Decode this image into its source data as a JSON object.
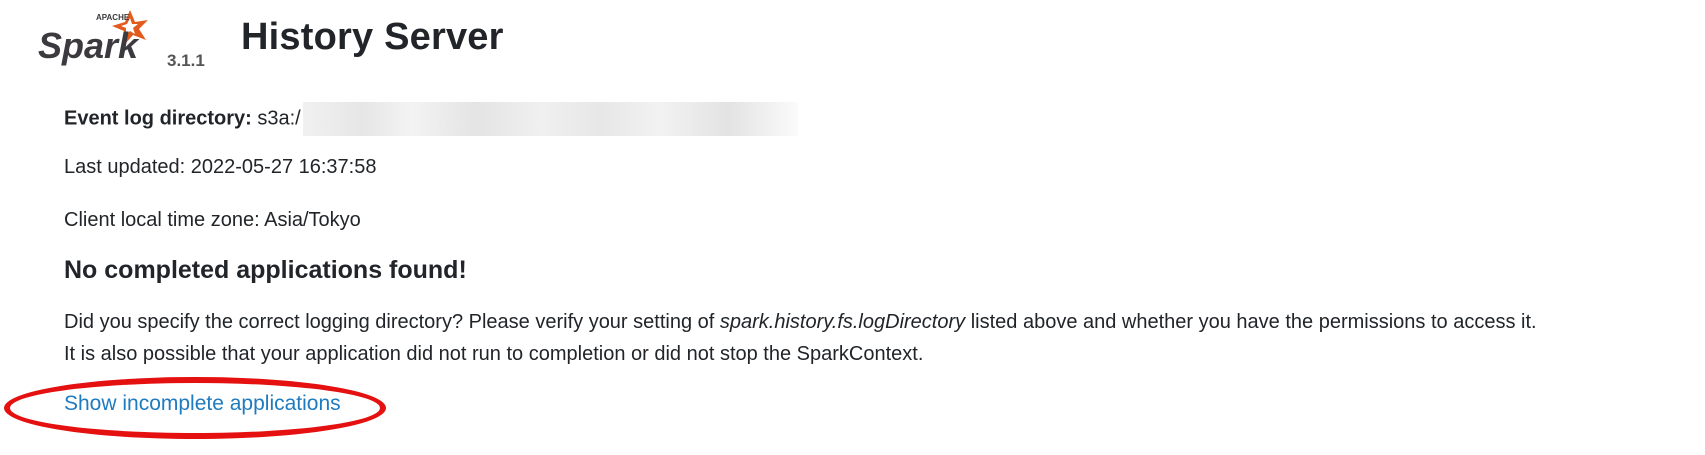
{
  "header": {
    "logo_text": "Spark",
    "logo_subtext": "APACHE",
    "version": "3.1.1",
    "title": "History Server"
  },
  "info": {
    "event_log_label": "Event log directory:",
    "event_log_value": "s3a:/",
    "last_updated": "Last updated: 2022-05-27 16:37:58",
    "timezone": "Client local time zone: Asia/Tokyo"
  },
  "empty_state": {
    "heading": "No completed applications found!",
    "line1_prefix": "Did you specify the correct logging directory? Please verify your setting of ",
    "line1_setting": "spark.history.fs.logDirectory",
    "line1_suffix": " listed above and whether you have the permissions to access it.",
    "line2": "It is also possible that your application did not run to completion or did not stop the SparkContext."
  },
  "links": {
    "show_incomplete": "Show incomplete applications"
  },
  "colors": {
    "link": "#1f7bbf",
    "annotation": "#e51010"
  }
}
